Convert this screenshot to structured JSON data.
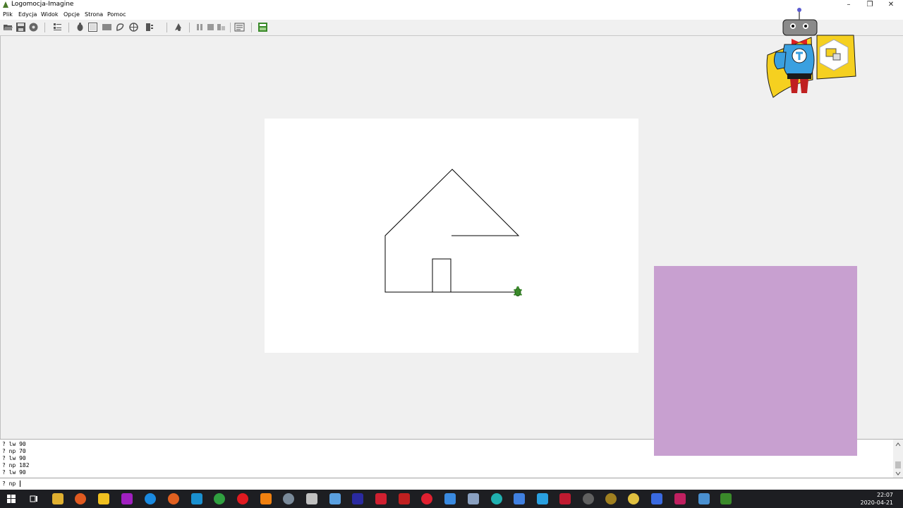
{
  "window": {
    "title": "Logomocja-Imagine",
    "minimize": "–",
    "restore": "❐",
    "close": "✕"
  },
  "menu": [
    "Plik",
    "Edycja",
    "Widok",
    "Opcje",
    "Strona",
    "Pomoc"
  ],
  "toolbar": {
    "buttons": [
      "open-icon",
      "save-icon",
      "print-icon",
      "list-icon",
      "turtle-icon",
      "page-icon",
      "pane-icon",
      "shape-icon",
      "paint-icon",
      "tools-icon",
      "run-icon",
      "pause-icon",
      "stop-icon",
      "step-icon",
      "text-icon",
      "grid-icon"
    ]
  },
  "console": {
    "lines": [
      "? lw 90",
      "? np 70",
      "? lw 90",
      "? np 182",
      "? lw 90"
    ],
    "input": "? np"
  },
  "colors": {
    "panel": "#c8a0d0",
    "turtle": "#3a8a2a"
  },
  "taskbar": {
    "time": "22:07",
    "date": "2020-04-21"
  }
}
